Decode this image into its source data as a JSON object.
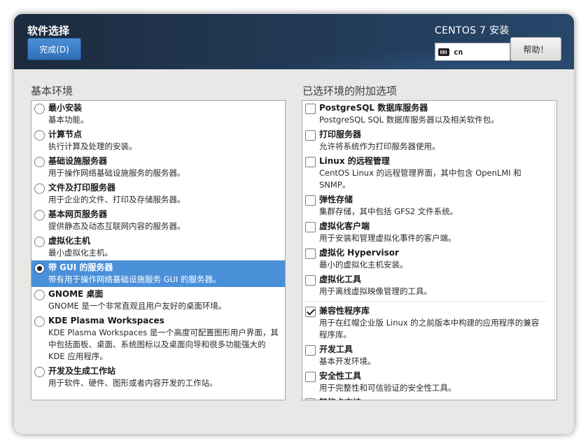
{
  "header": {
    "title": "软件选择",
    "done_label": "完成(D)",
    "product": "CENTOS 7 安装",
    "keyboard_layout": "cn",
    "help_label": "帮助！"
  },
  "left": {
    "label": "基本环境",
    "environments": [
      {
        "title": "最小安装",
        "desc": "基本功能。",
        "selected": false
      },
      {
        "title": "计算节点",
        "desc": "执行计算及处理的安装。",
        "selected": false
      },
      {
        "title": "基础设施服务器",
        "desc": "用于操作网络基础设施服务的服务器。",
        "selected": false
      },
      {
        "title": "文件及打印服务器",
        "desc": "用于企业的文件、打印及存储服务器。",
        "selected": false
      },
      {
        "title": "基本网页服务器",
        "desc": "提供静态及动态互联网内容的服务器。",
        "selected": false
      },
      {
        "title": "虚拟化主机",
        "desc": "最小虚拟化主机。",
        "selected": false
      },
      {
        "title": "带 GUI 的服务器",
        "desc": "带有用于操作网络基础设施服务 GUI 的服务器。",
        "selected": true
      },
      {
        "title": "GNOME 桌面",
        "desc": "GNOME 是一个非常直观且用户友好的桌面环境。",
        "selected": false
      },
      {
        "title": "KDE Plasma Workspaces",
        "desc": "KDE Plasma Workspaces 是一个高度可配置图形用户界面，其中包括面板、桌面、系统图标以及桌面向导和很多功能强大的 KDE 应用程序。",
        "selected": false
      },
      {
        "title": "开发及生成工作站",
        "desc": "用于软件、硬件、图形或者内容开发的工作站。",
        "selected": false
      }
    ]
  },
  "right": {
    "label": "已选环境的附加选项",
    "addons_group1": [
      {
        "title": "PostgreSQL 数据库服务器",
        "desc": "PostgreSQL SQL 数据库服务器以及相关软件包。",
        "checked": false
      },
      {
        "title": "打印服务器",
        "desc": "允许将系统作为打印服务器使用。",
        "checked": false
      },
      {
        "title": "Linux 的远程管理",
        "desc": "CentOS Linux 的远程管理界面，其中包含 OpenLMI 和 SNMP。",
        "checked": false
      },
      {
        "title": "弹性存储",
        "desc": "集群存储，其中包括 GFS2 文件系统。",
        "checked": false
      },
      {
        "title": "虚拟化客户端",
        "desc": "用于安装和管理虚拟化事件的客户端。",
        "checked": false
      },
      {
        "title": "虚拟化 Hypervisor",
        "desc": "最小的虚拟化主机安装。",
        "checked": false
      },
      {
        "title": "虚拟化工具",
        "desc": "用于离线虚拟映像管理的工具。",
        "checked": false
      }
    ],
    "addons_group2": [
      {
        "title": "兼容性程序库",
        "desc": "用于在红帽企业版 Linux 的之前版本中构建的应用程序的兼容程序库。",
        "checked": true
      },
      {
        "title": "开发工具",
        "desc": "基本开发环境。",
        "checked": false
      },
      {
        "title": "安全性工具",
        "desc": "用于完整性和可信验证的安全性工具。",
        "checked": false
      },
      {
        "title": "智能卡支持",
        "desc": "",
        "checked": false
      }
    ]
  }
}
